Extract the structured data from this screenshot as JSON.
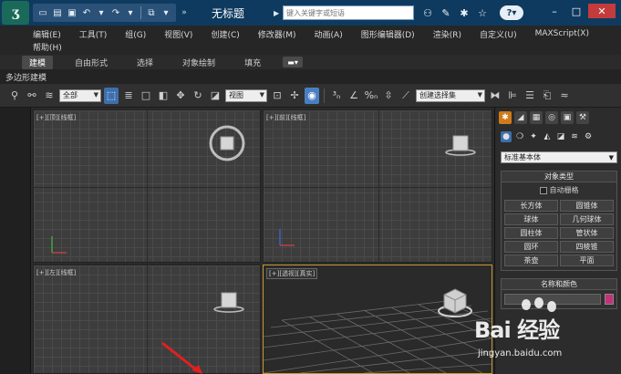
{
  "window": {
    "title": "无标题",
    "search_placeholder": "键入关键字或短语"
  },
  "menus": {
    "row1": [
      "编辑(E)",
      "工具(T)",
      "组(G)",
      "视图(V)",
      "创建(C)",
      "修改器(M)",
      "动画(A)",
      "图形编辑器(D)",
      "渲染(R)",
      "自定义(U)",
      "MAXScript(X)"
    ],
    "row2": [
      "帮助(H)"
    ]
  },
  "ribbon": {
    "tabs": [
      "建模",
      "自由形式",
      "选择",
      "对象绘制",
      "填充"
    ],
    "active_tab": "建模",
    "sub_label": "多边形建模"
  },
  "toolbar": {
    "selection_filter": "全部",
    "ref_coord": "视图",
    "named_selection": "创建选择集"
  },
  "viewports": {
    "top_label": "[+][顶][线框]",
    "front_label": "[+][前][线框]",
    "left_label": "[+][左][线框]",
    "persp_label": "[+][透视][真实]"
  },
  "command_panel": {
    "category": "标准基本体",
    "object_type_header": "对象类型",
    "autogrid_label": "自动栅格",
    "buttons": [
      "长方体",
      "圆锥体",
      "球体",
      "几何球体",
      "圆柱体",
      "管状体",
      "圆环",
      "四棱锥",
      "茶壶",
      "平面"
    ],
    "name_color_header": "名称和颜色",
    "object_color": "#c0337a"
  },
  "watermark": {
    "brand": "Bai 经验",
    "url": "jingyan.baidu.com"
  },
  "icons": {
    "app": "3ds-max-logo",
    "help": "?"
  }
}
